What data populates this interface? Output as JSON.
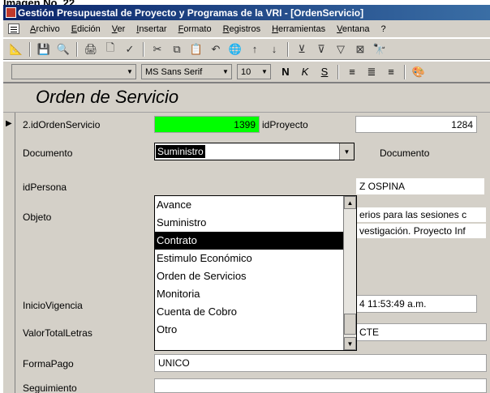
{
  "caption": "Imagen No. 22",
  "window": {
    "title": "Gestión Presupuestal de Proyecto y Programas  de la VRI - [OrdenServicio]"
  },
  "menu": [
    "Archivo",
    "Edición",
    "Ver",
    "Insertar",
    "Formato",
    "Registros",
    "Herramientas",
    "Ventana",
    "?"
  ],
  "toolbar": {
    "view_icon": "design-view-icon",
    "font_name": "MS Sans Serif",
    "font_size": "10",
    "bold": "N",
    "italic": "K",
    "underline": "S"
  },
  "form": {
    "title": "Orden de Servicio",
    "fields": {
      "idOrdenServicio_label": "2.idOrdenServicio",
      "idOrdenServicio_value": "1399",
      "idProyecto_label": "idProyecto",
      "idProyecto_value": "1284",
      "documento_label": "Documento",
      "documento_value": "Suministro",
      "documento2_label": "Documento",
      "idPersona_label": "idPersona",
      "idPersona_value": "Z  OSPINA",
      "objeto_label": "Objeto",
      "objeto_line1": "erios para las sesiones c",
      "objeto_line2": "vestigación. Proyecto Inf",
      "inicio_label": "InicioVigencia",
      "inicio_value": "4 11:53:49 a.m.",
      "valor_label": "ValorTotalLetras",
      "valor_value": "CTE",
      "forma_label": "FormaPago",
      "forma_value": "UNICO",
      "seguimiento_label": "Seguimiento"
    },
    "dropdown": {
      "options": [
        "Avance",
        "Suministro",
        "Contrato",
        "Estimulo Económico",
        "Orden de Servicios",
        "Monitoria",
        "Cuenta de Cobro",
        "Otro"
      ],
      "selected_index": 2
    }
  }
}
